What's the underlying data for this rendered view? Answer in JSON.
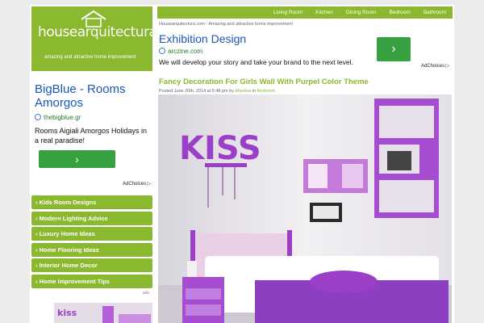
{
  "logo": {
    "text_a": "house",
    "text_b": "arquitectura",
    "tagline": "amazing and attractive home improvement"
  },
  "nav": {
    "items": [
      "Living Room",
      "Kitchen",
      "Dining Room",
      "Bedroom",
      "Bathroom"
    ]
  },
  "breadcrumb": "Housearquitectura.com - Amazing and attractive home improvement",
  "ad_top": {
    "title": "Exhibition Design",
    "url": "arczine.com",
    "desc": "We will develop your story and take your brand to the next level.",
    "button": "›",
    "adchoices": "AdChoices ▷"
  },
  "ad_left": {
    "title": "BigBlue - Rooms Amorgos",
    "url": "thebigblue.gr",
    "desc": "Rooms Aigiali Amorgos Holidays in a real paradise!",
    "button": "›",
    "adchoices": "AdChoices ▷"
  },
  "categories": {
    "items": [
      "› Kids Room Designs",
      "› Modern Lighting Advice",
      "› Luxury Home Ideas",
      "› Home Flooring Ideas",
      "› Interior Home Decor",
      "› Home Improvement Tips"
    ],
    "ads_label": "ads"
  },
  "post": {
    "title": "Fancy Decoration For Girls Wall With Purpel Color Theme",
    "meta_prefix": "Posted June 20th, 2014 at 5:48 pm by ",
    "author": "Elbetina",
    "meta_in": " in ",
    "category": "Bedroom",
    "wall_sign": "KISS"
  },
  "colors": {
    "brand_green": "#8ab82e",
    "ad_button": "#37a041",
    "ad_link": "#1a55b8",
    "accent_purple": "#9b3fc8"
  }
}
